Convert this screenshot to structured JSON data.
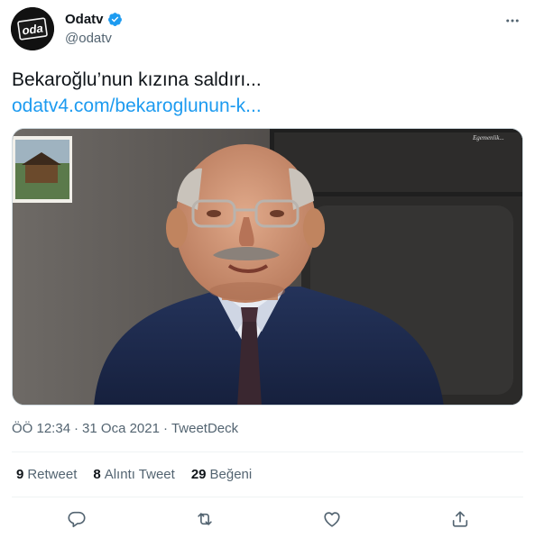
{
  "author": {
    "name": "Odatv",
    "handle": "@odatv",
    "verified": true,
    "avatar_logo_text": "odatv"
  },
  "tweet": {
    "text": "Bekaroğlu’nun kızına saldırı...",
    "link_text": "odatv4.com/bekaroglunun-k..."
  },
  "media": {
    "image_watermark": "Egemenlik..."
  },
  "meta": {
    "time": "ÖÖ 12:34",
    "separator": "·",
    "date": "31 Oca 2021",
    "source": "TweetDeck"
  },
  "stats": {
    "retweets_count": "9",
    "retweets_label": "Retweet",
    "quotes_count": "8",
    "quotes_label": "Alıntı Tweet",
    "likes_count": "29",
    "likes_label": "Beğeni"
  },
  "actions": [
    "reply-icon",
    "retweet-icon",
    "like-icon",
    "share-icon"
  ],
  "colors": {
    "link": "#1d9bf0",
    "secondary_text": "#536471",
    "primary_text": "#0f1419",
    "divider": "#eff3f4",
    "verified": "#1d9bf0"
  }
}
